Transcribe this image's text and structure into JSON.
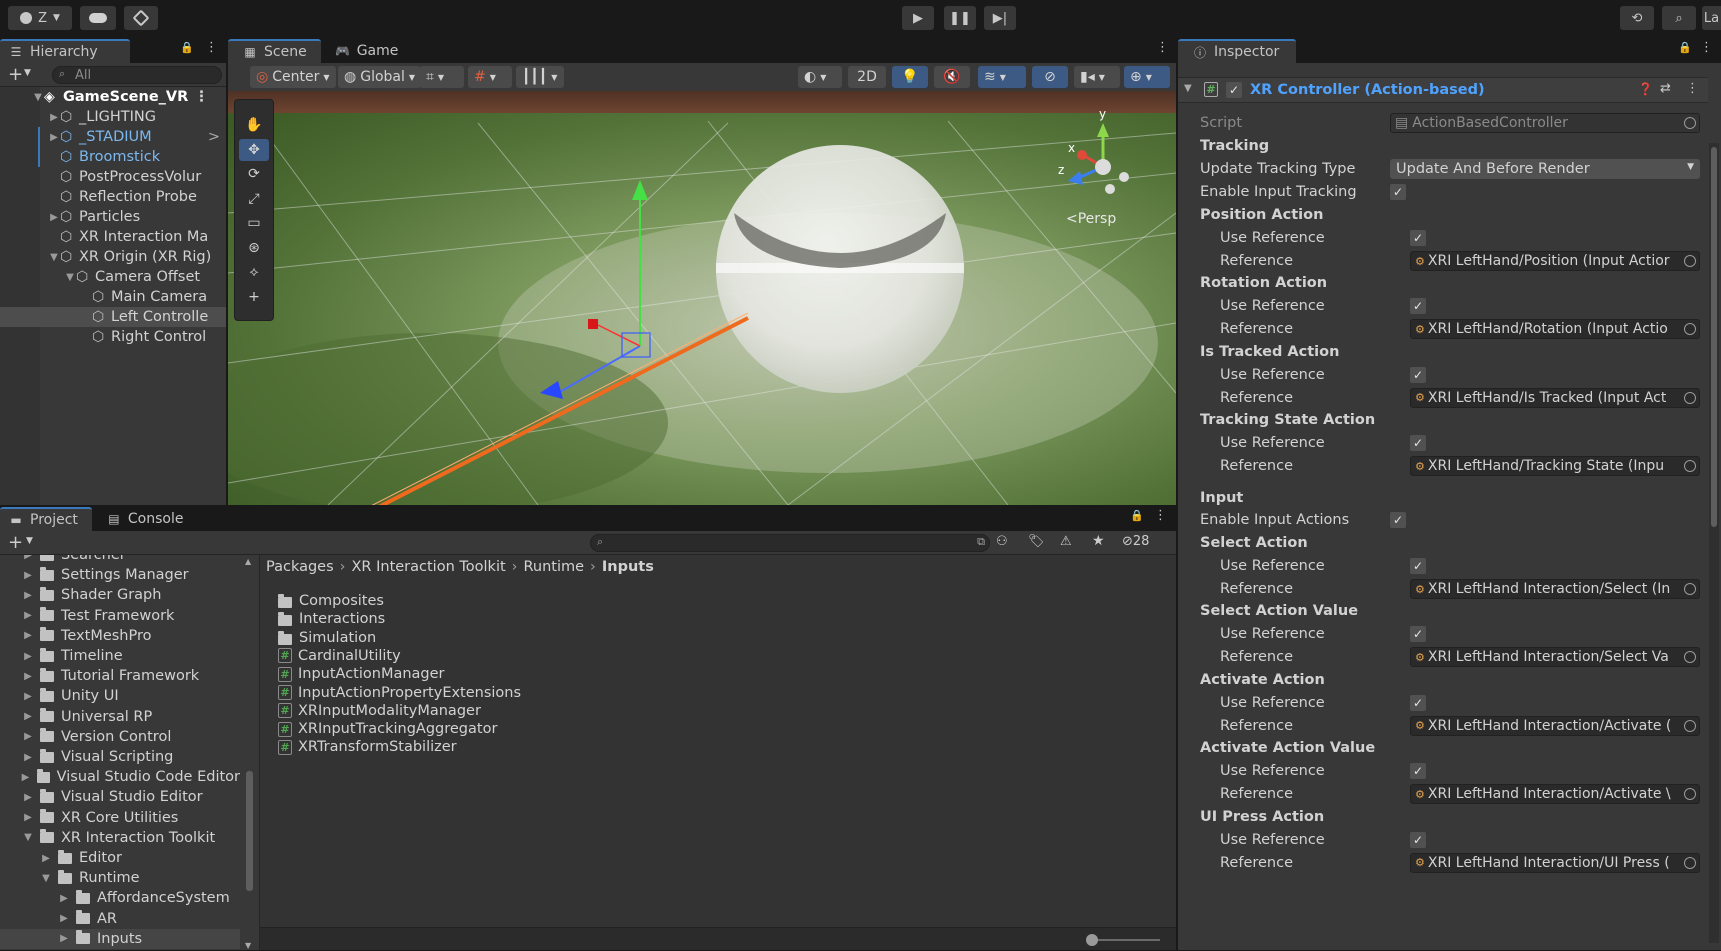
{
  "topbar": {
    "account_label": "Z",
    "account_icon": "account-icon",
    "cloud_icon": "cloud-icon",
    "collab_icon": "collab-icon",
    "play_icon": "play-icon",
    "pause_icon": "pause-icon",
    "step_icon": "step-icon",
    "history_icon": "history-icon",
    "search_icon": "search-icon",
    "layout_label": "La"
  },
  "hierarchy": {
    "tab_label": "Hierarchy",
    "search_placeholder": "All",
    "items": [
      {
        "label": "GameScene_VR",
        "indent": 0,
        "expanded": true,
        "kind": "scene",
        "color": "#ffffff",
        "bold": true
      },
      {
        "label": "_LIGHTING",
        "indent": 1,
        "expanded": false,
        "kind": "go",
        "color": "#d2d2d2"
      },
      {
        "label": "_STADIUM",
        "indent": 1,
        "expanded": false,
        "kind": "prefab",
        "color": "#7cb8f0"
      },
      {
        "label": "Broomstick",
        "indent": 1,
        "expanded": null,
        "kind": "prefab",
        "color": "#7cb8f0"
      },
      {
        "label": "PostProcessVolur",
        "indent": 1,
        "expanded": null,
        "kind": "go",
        "color": "#d2d2d2"
      },
      {
        "label": "Reflection Probe",
        "indent": 1,
        "expanded": null,
        "kind": "go",
        "color": "#d2d2d2"
      },
      {
        "label": "Particles",
        "indent": 1,
        "expanded": false,
        "kind": "go",
        "color": "#d2d2d2"
      },
      {
        "label": "XR Interaction Ma",
        "indent": 1,
        "expanded": null,
        "kind": "go",
        "color": "#d2d2d2"
      },
      {
        "label": "XR Origin (XR Rig)",
        "indent": 1,
        "expanded": true,
        "kind": "go",
        "color": "#d2d2d2"
      },
      {
        "label": "Camera Offset",
        "indent": 2,
        "expanded": true,
        "kind": "go",
        "color": "#d2d2d2"
      },
      {
        "label": "Main Camera",
        "indent": 3,
        "expanded": null,
        "kind": "go",
        "color": "#d2d2d2"
      },
      {
        "label": "Left Controlle",
        "indent": 3,
        "expanded": null,
        "kind": "go",
        "color": "#d2d2d2",
        "selected": true
      },
      {
        "label": "Right Control",
        "indent": 3,
        "expanded": null,
        "kind": "go",
        "color": "#d2d2d2"
      }
    ]
  },
  "scene": {
    "tab_scene": "Scene",
    "tab_game": "Game",
    "pivot_label": "Center",
    "space_label": "Global",
    "mode_2d": "2D",
    "persp_label": "Persp",
    "axis_x": "x",
    "axis_y": "y",
    "axis_z": "z",
    "tools": [
      "hand-tool-icon",
      "move-tool-icon",
      "rotate-tool-icon",
      "scale-tool-icon",
      "rect-tool-icon",
      "transform-tool-icon",
      "custom-tool-icon",
      "add-tool-icon"
    ]
  },
  "project": {
    "tab_project": "Project",
    "tab_console": "Console",
    "hidden_count": "28",
    "breadcrumb": [
      "Packages",
      "XR Interaction Toolkit",
      "Runtime",
      "Inputs"
    ],
    "tree": [
      {
        "label": "Searcher",
        "indent": 0,
        "expanded": false
      },
      {
        "label": "Settings Manager",
        "indent": 0,
        "expanded": false
      },
      {
        "label": "Shader Graph",
        "indent": 0,
        "expanded": false
      },
      {
        "label": "Test Framework",
        "indent": 0,
        "expanded": false
      },
      {
        "label": "TextMeshPro",
        "indent": 0,
        "expanded": false
      },
      {
        "label": "Timeline",
        "indent": 0,
        "expanded": false
      },
      {
        "label": "Tutorial Framework",
        "indent": 0,
        "expanded": false
      },
      {
        "label": "Unity UI",
        "indent": 0,
        "expanded": false
      },
      {
        "label": "Universal RP",
        "indent": 0,
        "expanded": false
      },
      {
        "label": "Version Control",
        "indent": 0,
        "expanded": false
      },
      {
        "label": "Visual Scripting",
        "indent": 0,
        "expanded": false
      },
      {
        "label": "Visual Studio Code Editor",
        "indent": 0,
        "expanded": false
      },
      {
        "label": "Visual Studio Editor",
        "indent": 0,
        "expanded": false
      },
      {
        "label": "XR Core Utilities",
        "indent": 0,
        "expanded": false
      },
      {
        "label": "XR Interaction Toolkit",
        "indent": 0,
        "expanded": true
      },
      {
        "label": "Editor",
        "indent": 1,
        "expanded": false
      },
      {
        "label": "Runtime",
        "indent": 1,
        "expanded": true
      },
      {
        "label": "AffordanceSystem",
        "indent": 2,
        "expanded": false
      },
      {
        "label": "AR",
        "indent": 2,
        "expanded": false
      },
      {
        "label": "Inputs",
        "indent": 2,
        "expanded": false,
        "selected": true
      }
    ],
    "files": [
      {
        "label": "Composites",
        "type": "folder"
      },
      {
        "label": "Interactions",
        "type": "folder"
      },
      {
        "label": "Simulation",
        "type": "folder"
      },
      {
        "label": "CardinalUtility",
        "type": "script"
      },
      {
        "label": "InputActionManager",
        "type": "script"
      },
      {
        "label": "InputActionPropertyExtensions",
        "type": "script"
      },
      {
        "label": "XRInputModalityManager",
        "type": "script"
      },
      {
        "label": "XRInputTrackingAggregator",
        "type": "script"
      },
      {
        "label": "XRTransformStabilizer",
        "type": "script"
      }
    ]
  },
  "inspector": {
    "tab_label": "Inspector",
    "component_title": "XR Controller (Action-based)",
    "script_label": "Script",
    "script_value": "ActionBasedController",
    "tracking_header": "Tracking",
    "update_tracking_label": "Update Tracking Type",
    "update_tracking_value": "Update And Before Render",
    "enable_input_tracking": "Enable Input Tracking",
    "input_header": "Input",
    "enable_input_actions": "Enable Input Actions",
    "use_reference": "Use Reference",
    "reference": "Reference",
    "tracking_actions": [
      {
        "name": "Position Action",
        "ref": "XRI LeftHand/Position (Input Actior"
      },
      {
        "name": "Rotation Action",
        "ref": "XRI LeftHand/Rotation (Input Actio"
      },
      {
        "name": "Is Tracked Action",
        "ref": "XRI LeftHand/Is Tracked (Input Act"
      },
      {
        "name": "Tracking State Action",
        "ref": "XRI LeftHand/Tracking State (Inpu"
      }
    ],
    "input_actions": [
      {
        "name": "Select Action",
        "ref": "XRI LeftHand Interaction/Select (In"
      },
      {
        "name": "Select Action Value",
        "ref": "XRI LeftHand Interaction/Select Va"
      },
      {
        "name": "Activate Action",
        "ref": "XRI LeftHand Interaction/Activate ("
      },
      {
        "name": "Activate Action Value",
        "ref": "XRI LeftHand Interaction/Activate \\"
      },
      {
        "name": "UI Press Action",
        "ref": "XRI LeftHand Interaction/UI Press ("
      }
    ]
  }
}
